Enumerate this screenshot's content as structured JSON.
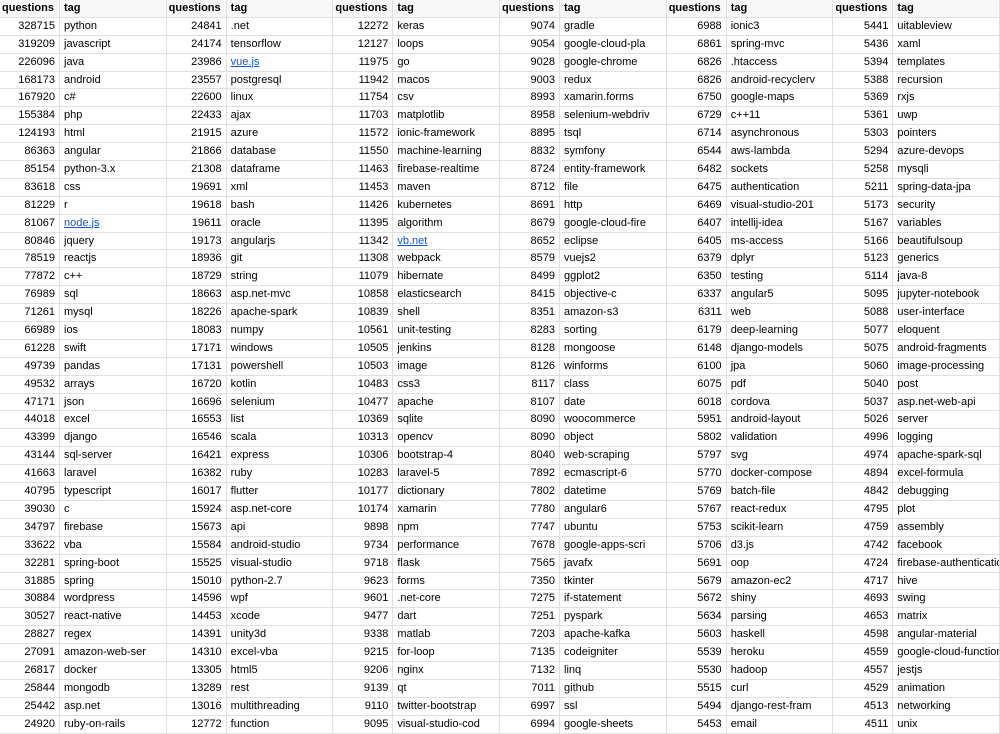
{
  "headers": {
    "questions": "questions",
    "tag": "tag"
  },
  "columns": [
    [
      {
        "q": 328715,
        "t": "python"
      },
      {
        "q": 319209,
        "t": "javascript"
      },
      {
        "q": 226096,
        "t": "java"
      },
      {
        "q": 168173,
        "t": "android"
      },
      {
        "q": 167920,
        "t": "c#"
      },
      {
        "q": 155384,
        "t": "php"
      },
      {
        "q": 124193,
        "t": "html"
      },
      {
        "q": 86363,
        "t": "angular"
      },
      {
        "q": 85154,
        "t": "python-3.x"
      },
      {
        "q": 83618,
        "t": "css"
      },
      {
        "q": 81229,
        "t": "r"
      },
      {
        "q": 81067,
        "t": "node.js",
        "link": true
      },
      {
        "q": 80846,
        "t": "jquery"
      },
      {
        "q": 78519,
        "t": "reactjs"
      },
      {
        "q": 77872,
        "t": "c++"
      },
      {
        "q": 76989,
        "t": "sql"
      },
      {
        "q": 71261,
        "t": "mysql"
      },
      {
        "q": 66989,
        "t": "ios"
      },
      {
        "q": 61228,
        "t": "swift"
      },
      {
        "q": 49739,
        "t": "pandas"
      },
      {
        "q": 49532,
        "t": "arrays"
      },
      {
        "q": 47171,
        "t": "json"
      },
      {
        "q": 44018,
        "t": "excel"
      },
      {
        "q": 43399,
        "t": "django"
      },
      {
        "q": 43144,
        "t": "sql-server"
      },
      {
        "q": 41663,
        "t": "laravel"
      },
      {
        "q": 40795,
        "t": "typescript"
      },
      {
        "q": 39030,
        "t": "c"
      },
      {
        "q": 34797,
        "t": "firebase"
      },
      {
        "q": 33622,
        "t": "vba"
      },
      {
        "q": 32281,
        "t": "spring-boot"
      },
      {
        "q": 31885,
        "t": "spring"
      },
      {
        "q": 30884,
        "t": "wordpress"
      },
      {
        "q": 30527,
        "t": "react-native"
      },
      {
        "q": 28827,
        "t": "regex"
      },
      {
        "q": 27091,
        "t": "amazon-web-ser"
      },
      {
        "q": 26817,
        "t": "docker"
      },
      {
        "q": 25844,
        "t": "mongodb"
      },
      {
        "q": 25442,
        "t": "asp.net"
      },
      {
        "q": 24920,
        "t": "ruby-on-rails"
      }
    ],
    [
      {
        "q": 24841,
        "t": ".net"
      },
      {
        "q": 24174,
        "t": "tensorflow"
      },
      {
        "q": 23986,
        "t": "vue.js",
        "link": true
      },
      {
        "q": 23557,
        "t": "postgresql"
      },
      {
        "q": 22600,
        "t": "linux"
      },
      {
        "q": 22433,
        "t": "ajax"
      },
      {
        "q": 21915,
        "t": "azure"
      },
      {
        "q": 21866,
        "t": "database"
      },
      {
        "q": 21308,
        "t": "dataframe"
      },
      {
        "q": 19691,
        "t": "xml"
      },
      {
        "q": 19618,
        "t": "bash"
      },
      {
        "q": 19611,
        "t": "oracle"
      },
      {
        "q": 19173,
        "t": "angularjs"
      },
      {
        "q": 18936,
        "t": "git"
      },
      {
        "q": 18729,
        "t": "string"
      },
      {
        "q": 18663,
        "t": "asp.net-mvc"
      },
      {
        "q": 18226,
        "t": "apache-spark"
      },
      {
        "q": 18083,
        "t": "numpy"
      },
      {
        "q": 17171,
        "t": "windows"
      },
      {
        "q": 17131,
        "t": "powershell"
      },
      {
        "q": 16720,
        "t": "kotlin"
      },
      {
        "q": 16696,
        "t": "selenium"
      },
      {
        "q": 16553,
        "t": "list"
      },
      {
        "q": 16546,
        "t": "scala"
      },
      {
        "q": 16421,
        "t": "express"
      },
      {
        "q": 16382,
        "t": "ruby"
      },
      {
        "q": 16017,
        "t": "flutter"
      },
      {
        "q": 15924,
        "t": "asp.net-core"
      },
      {
        "q": 15673,
        "t": "api"
      },
      {
        "q": 15584,
        "t": "android-studio"
      },
      {
        "q": 15525,
        "t": "visual-studio"
      },
      {
        "q": 15010,
        "t": "python-2.7"
      },
      {
        "q": 14596,
        "t": "wpf"
      },
      {
        "q": 14453,
        "t": "xcode"
      },
      {
        "q": 14391,
        "t": "unity3d"
      },
      {
        "q": 14310,
        "t": "excel-vba"
      },
      {
        "q": 13305,
        "t": "html5"
      },
      {
        "q": 13289,
        "t": "rest"
      },
      {
        "q": 13016,
        "t": "multithreading"
      },
      {
        "q": 12772,
        "t": "function"
      }
    ],
    [
      {
        "q": 12272,
        "t": "keras"
      },
      {
        "q": 12127,
        "t": "loops"
      },
      {
        "q": 11975,
        "t": "go"
      },
      {
        "q": 11942,
        "t": "macos"
      },
      {
        "q": 11754,
        "t": "csv"
      },
      {
        "q": 11703,
        "t": "matplotlib"
      },
      {
        "q": 11572,
        "t": "ionic-framework"
      },
      {
        "q": 11550,
        "t": "machine-learning"
      },
      {
        "q": 11463,
        "t": "firebase-realtime"
      },
      {
        "q": 11453,
        "t": "maven"
      },
      {
        "q": 11426,
        "t": "kubernetes"
      },
      {
        "q": 11395,
        "t": "algorithm"
      },
      {
        "q": 11342,
        "t": "vb.net",
        "link": true
      },
      {
        "q": 11308,
        "t": "webpack"
      },
      {
        "q": 11079,
        "t": "hibernate"
      },
      {
        "q": 10858,
        "t": "elasticsearch"
      },
      {
        "q": 10839,
        "t": "shell"
      },
      {
        "q": 10561,
        "t": "unit-testing"
      },
      {
        "q": 10505,
        "t": "jenkins"
      },
      {
        "q": 10503,
        "t": "image"
      },
      {
        "q": 10483,
        "t": "css3"
      },
      {
        "q": 10477,
        "t": "apache"
      },
      {
        "q": 10369,
        "t": "sqlite"
      },
      {
        "q": 10313,
        "t": "opencv"
      },
      {
        "q": 10306,
        "t": "bootstrap-4"
      },
      {
        "q": 10283,
        "t": "laravel-5"
      },
      {
        "q": 10177,
        "t": "dictionary"
      },
      {
        "q": 10174,
        "t": "xamarin"
      },
      {
        "q": 9898,
        "t": "npm"
      },
      {
        "q": 9734,
        "t": "performance"
      },
      {
        "q": 9718,
        "t": "flask"
      },
      {
        "q": 9623,
        "t": "forms"
      },
      {
        "q": 9601,
        "t": ".net-core"
      },
      {
        "q": 9477,
        "t": "dart"
      },
      {
        "q": 9338,
        "t": "matlab"
      },
      {
        "q": 9215,
        "t": "for-loop"
      },
      {
        "q": 9206,
        "t": "nginx"
      },
      {
        "q": 9139,
        "t": "qt"
      },
      {
        "q": 9110,
        "t": "twitter-bootstrap"
      },
      {
        "q": 9095,
        "t": "visual-studio-cod"
      }
    ],
    [
      {
        "q": 9074,
        "t": "gradle"
      },
      {
        "q": 9054,
        "t": "google-cloud-pla"
      },
      {
        "q": 9028,
        "t": "google-chrome"
      },
      {
        "q": 9003,
        "t": "redux"
      },
      {
        "q": 8993,
        "t": "xamarin.forms"
      },
      {
        "q": 8958,
        "t": "selenium-webdriv"
      },
      {
        "q": 8895,
        "t": "tsql"
      },
      {
        "q": 8832,
        "t": "symfony"
      },
      {
        "q": 8724,
        "t": "entity-framework"
      },
      {
        "q": 8712,
        "t": "file"
      },
      {
        "q": 8691,
        "t": "http"
      },
      {
        "q": 8679,
        "t": "google-cloud-fire"
      },
      {
        "q": 8652,
        "t": "eclipse"
      },
      {
        "q": 8579,
        "t": "vuejs2"
      },
      {
        "q": 8499,
        "t": "ggplot2"
      },
      {
        "q": 8415,
        "t": "objective-c"
      },
      {
        "q": 8351,
        "t": "amazon-s3"
      },
      {
        "q": 8283,
        "t": "sorting"
      },
      {
        "q": 8128,
        "t": "mongoose"
      },
      {
        "q": 8126,
        "t": "winforms"
      },
      {
        "q": 8117,
        "t": "class"
      },
      {
        "q": 8107,
        "t": "date"
      },
      {
        "q": 8090,
        "t": "woocommerce"
      },
      {
        "q": 8090,
        "t": "object"
      },
      {
        "q": 8040,
        "t": "web-scraping"
      },
      {
        "q": 7892,
        "t": "ecmascript-6"
      },
      {
        "q": 7802,
        "t": "datetime"
      },
      {
        "q": 7780,
        "t": "angular6"
      },
      {
        "q": 7747,
        "t": "ubuntu"
      },
      {
        "q": 7678,
        "t": "google-apps-scri"
      },
      {
        "q": 7565,
        "t": "javafx"
      },
      {
        "q": 7350,
        "t": "tkinter"
      },
      {
        "q": 7275,
        "t": "if-statement"
      },
      {
        "q": 7251,
        "t": "pyspark"
      },
      {
        "q": 7203,
        "t": "apache-kafka"
      },
      {
        "q": 7135,
        "t": "codeigniter"
      },
      {
        "q": 7132,
        "t": "linq"
      },
      {
        "q": 7011,
        "t": "github"
      },
      {
        "q": 6997,
        "t": "ssl"
      },
      {
        "q": 6994,
        "t": "google-sheets"
      }
    ],
    [
      {
        "q": 6988,
        "t": "ionic3"
      },
      {
        "q": 6861,
        "t": "spring-mvc"
      },
      {
        "q": 6826,
        "t": ".htaccess"
      },
      {
        "q": 6826,
        "t": "android-recyclerv"
      },
      {
        "q": 6750,
        "t": "google-maps"
      },
      {
        "q": 6729,
        "t": "c++11"
      },
      {
        "q": 6714,
        "t": "asynchronous"
      },
      {
        "q": 6544,
        "t": "aws-lambda"
      },
      {
        "q": 6482,
        "t": "sockets"
      },
      {
        "q": 6475,
        "t": "authentication"
      },
      {
        "q": 6469,
        "t": "visual-studio-201"
      },
      {
        "q": 6407,
        "t": "intellij-idea"
      },
      {
        "q": 6405,
        "t": "ms-access"
      },
      {
        "q": 6379,
        "t": "dplyr"
      },
      {
        "q": 6350,
        "t": "testing"
      },
      {
        "q": 6337,
        "t": "angular5"
      },
      {
        "q": 6311,
        "t": "web"
      },
      {
        "q": 6179,
        "t": "deep-learning"
      },
      {
        "q": 6148,
        "t": "django-models"
      },
      {
        "q": 6100,
        "t": "jpa"
      },
      {
        "q": 6075,
        "t": "pdf"
      },
      {
        "q": 6018,
        "t": "cordova"
      },
      {
        "q": 5951,
        "t": "android-layout"
      },
      {
        "q": 5802,
        "t": "validation"
      },
      {
        "q": 5797,
        "t": "svg"
      },
      {
        "q": 5770,
        "t": "docker-compose"
      },
      {
        "q": 5769,
        "t": "batch-file"
      },
      {
        "q": 5767,
        "t": "react-redux"
      },
      {
        "q": 5753,
        "t": "scikit-learn"
      },
      {
        "q": 5706,
        "t": "d3.js"
      },
      {
        "q": 5691,
        "t": "oop"
      },
      {
        "q": 5679,
        "t": "amazon-ec2"
      },
      {
        "q": 5672,
        "t": "shiny"
      },
      {
        "q": 5634,
        "t": "parsing"
      },
      {
        "q": 5603,
        "t": "haskell"
      },
      {
        "q": 5539,
        "t": "heroku"
      },
      {
        "q": 5530,
        "t": "hadoop"
      },
      {
        "q": 5515,
        "t": "curl"
      },
      {
        "q": 5494,
        "t": "django-rest-fram"
      },
      {
        "q": 5453,
        "t": "email"
      }
    ],
    [
      {
        "q": 5441,
        "t": "uitableview"
      },
      {
        "q": 5436,
        "t": "xaml"
      },
      {
        "q": 5394,
        "t": "templates"
      },
      {
        "q": 5388,
        "t": "recursion"
      },
      {
        "q": 5369,
        "t": "rxjs"
      },
      {
        "q": 5361,
        "t": "uwp"
      },
      {
        "q": 5303,
        "t": "pointers"
      },
      {
        "q": 5294,
        "t": "azure-devops"
      },
      {
        "q": 5258,
        "t": "mysqli"
      },
      {
        "q": 5211,
        "t": "spring-data-jpa"
      },
      {
        "q": 5173,
        "t": "security"
      },
      {
        "q": 5167,
        "t": "variables"
      },
      {
        "q": 5166,
        "t": "beautifulsoup"
      },
      {
        "q": 5123,
        "t": "generics"
      },
      {
        "q": 5114,
        "t": "java-8"
      },
      {
        "q": 5095,
        "t": "jupyter-notebook"
      },
      {
        "q": 5088,
        "t": "user-interface"
      },
      {
        "q": 5077,
        "t": "eloquent"
      },
      {
        "q": 5075,
        "t": "android-fragments"
      },
      {
        "q": 5060,
        "t": "image-processing"
      },
      {
        "q": 5040,
        "t": "post"
      },
      {
        "q": 5037,
        "t": "asp.net-web-api"
      },
      {
        "q": 5026,
        "t": "server"
      },
      {
        "q": 4996,
        "t": "logging"
      },
      {
        "q": 4974,
        "t": "apache-spark-sql"
      },
      {
        "q": 4894,
        "t": "excel-formula"
      },
      {
        "q": 4842,
        "t": "debugging"
      },
      {
        "q": 4795,
        "t": "plot"
      },
      {
        "q": 4759,
        "t": "assembly"
      },
      {
        "q": 4742,
        "t": "facebook"
      },
      {
        "q": 4724,
        "t": "firebase-authentication"
      },
      {
        "q": 4717,
        "t": "hive"
      },
      {
        "q": 4693,
        "t": "swing"
      },
      {
        "q": 4653,
        "t": "matrix"
      },
      {
        "q": 4598,
        "t": "angular-material"
      },
      {
        "q": 4559,
        "t": "google-cloud-functions"
      },
      {
        "q": 4557,
        "t": "jestjs"
      },
      {
        "q": 4529,
        "t": "animation"
      },
      {
        "q": 4513,
        "t": "networking"
      },
      {
        "q": 4511,
        "t": "unix"
      }
    ]
  ]
}
